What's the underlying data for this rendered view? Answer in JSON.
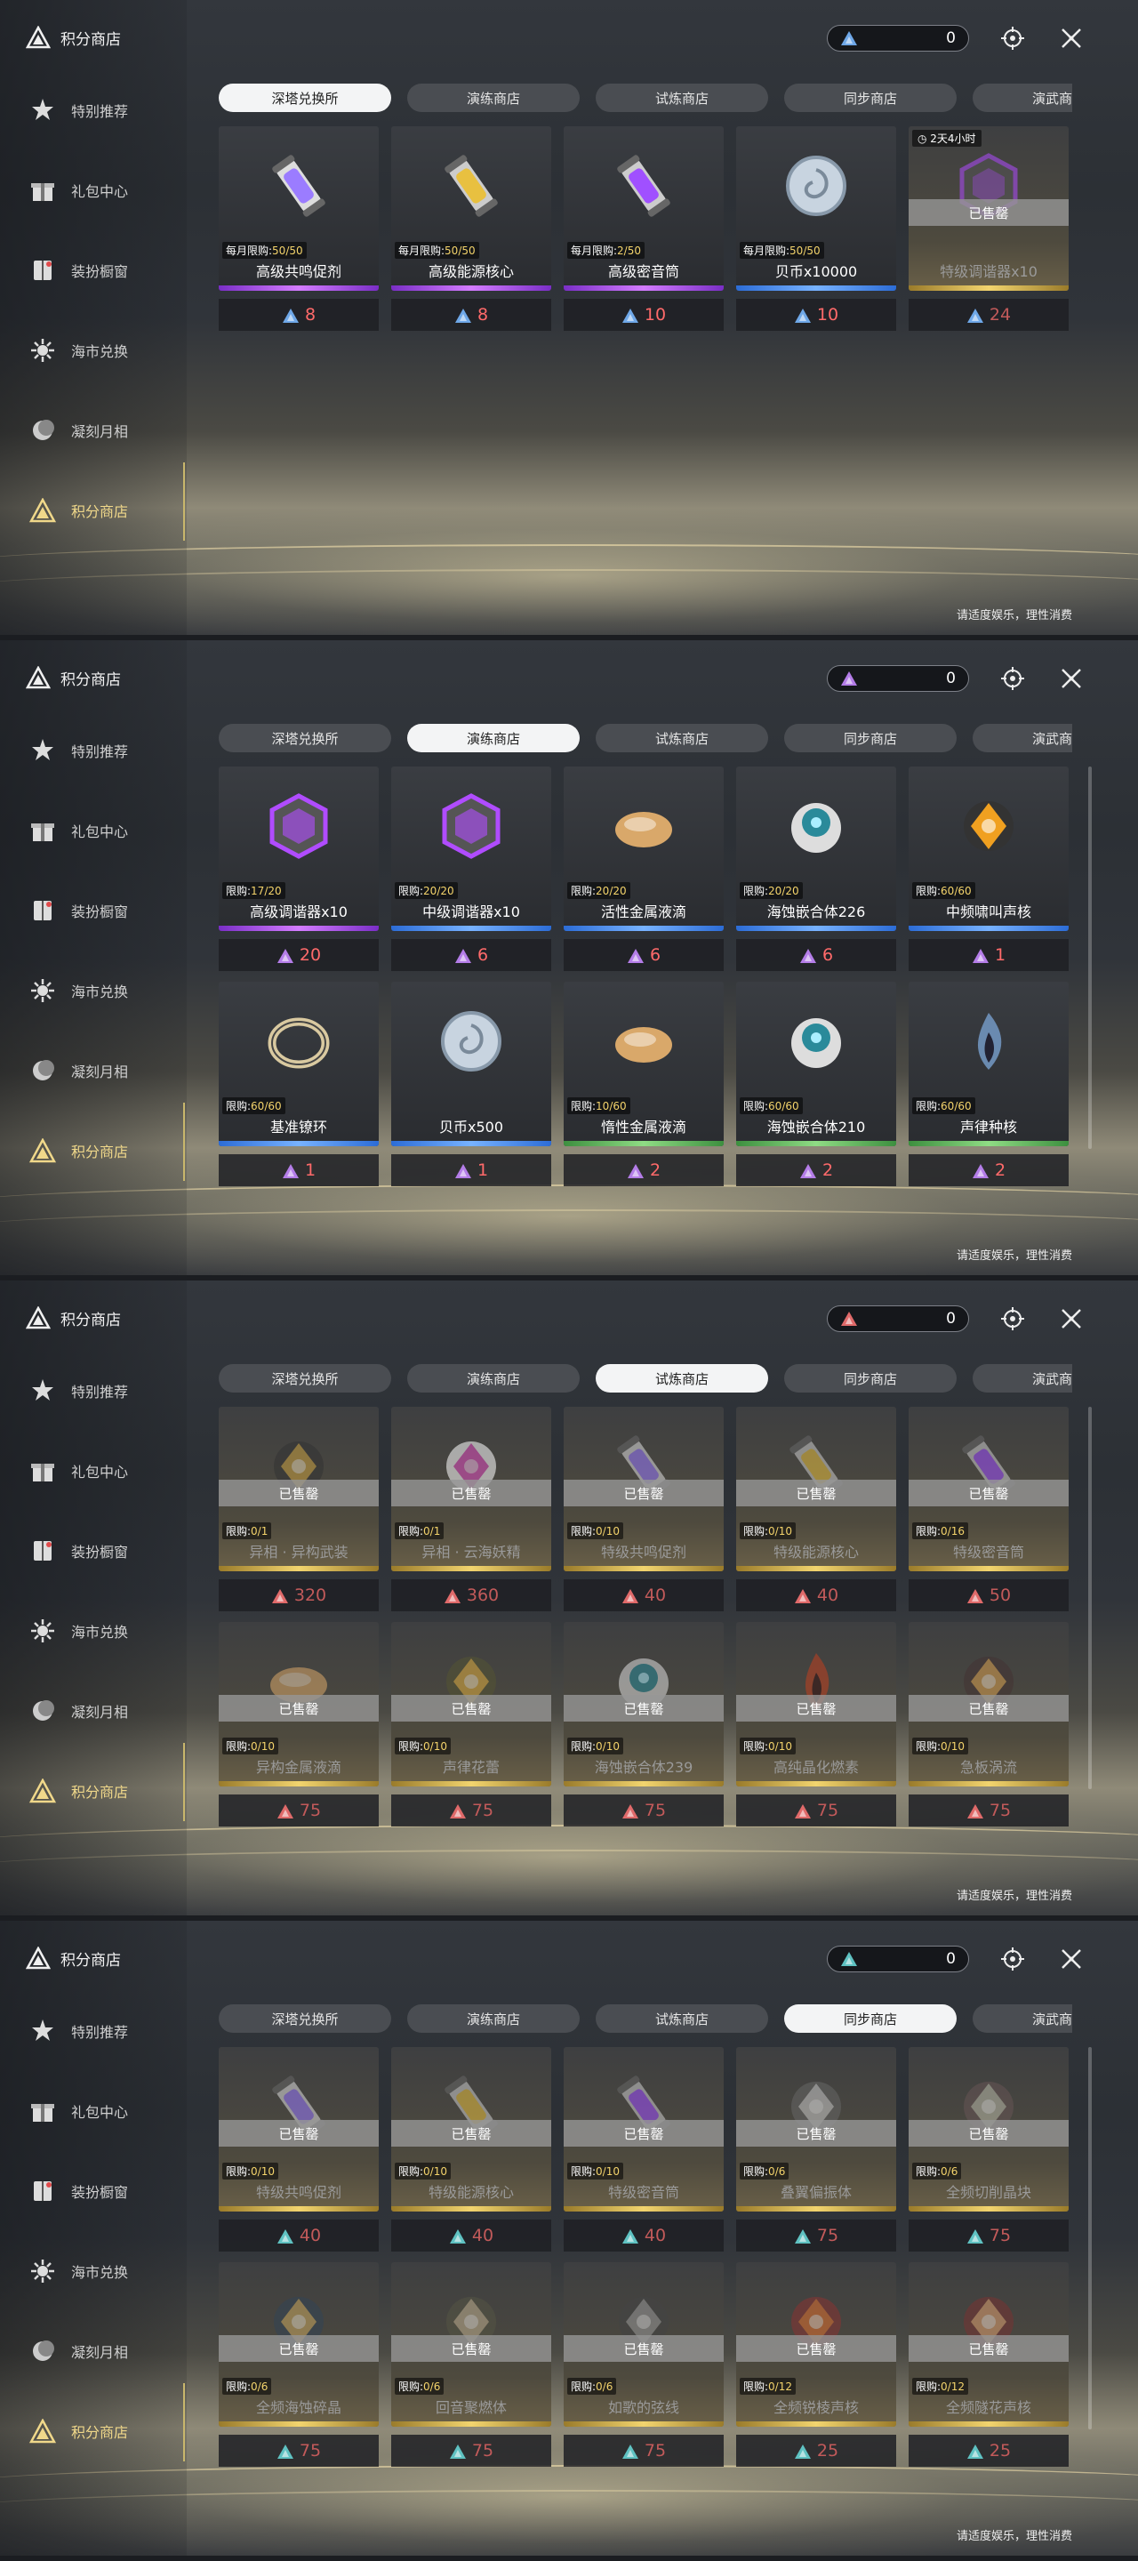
{
  "sidebar": {
    "title": "积分商店",
    "items": [
      {
        "label": "特别推荐",
        "icon": "star-hand-icon"
      },
      {
        "label": "礼包中心",
        "icon": "gift-icon"
      },
      {
        "label": "装扮橱窗",
        "icon": "wardrobe-icon"
      },
      {
        "label": "海市兑换",
        "icon": "exchange-icon"
      },
      {
        "label": "凝刻月相",
        "icon": "moon-icon"
      },
      {
        "label": "积分商店",
        "icon": "triangle-points-icon",
        "active": true
      }
    ]
  },
  "footnote": "请适度娱乐，理性消费",
  "tabs": [
    "深塔兑换所",
    "演练商店",
    "试炼商店",
    "同步商店",
    "演武商店"
  ],
  "panels": [
    {
      "currency": "0",
      "currency_color": "#6fa8e8",
      "selected_tab": 0,
      "items": [
        {
          "name": "高级共鸣促剂",
          "limit": "每月限购:",
          "count": "50/50",
          "price": "8",
          "rarity": "purple",
          "icon": "vial-icon"
        },
        {
          "name": "高级能源核心",
          "limit": "每月限购:",
          "count": "50/50",
          "price": "8",
          "rarity": "purple",
          "icon": "energy-core-icon"
        },
        {
          "name": "高级密音筒",
          "limit": "每月限购:",
          "count": "2/50",
          "price": "10",
          "rarity": "purple",
          "icon": "sound-tube-icon"
        },
        {
          "name": "贝币x10000",
          "limit": "每月限购:",
          "count": "50/50",
          "price": "10",
          "rarity": "blue",
          "icon": "shell-coin-icon"
        },
        {
          "name": "特级调谐器x10",
          "timer": "2天4小时",
          "sold": "已售罄",
          "price": "24",
          "rarity": "gold",
          "icon": "tuner-icon"
        }
      ]
    },
    {
      "currency": "0",
      "currency_color": "#b47de8",
      "selected_tab": 1,
      "items": [
        {
          "name": "高级调谐器x10",
          "limit": "限购:",
          "count": "17/20",
          "price": "20",
          "rarity": "purple",
          "icon": "tuner-icon"
        },
        {
          "name": "中级调谐器x10",
          "limit": "限购:",
          "count": "20/20",
          "price": "6",
          "rarity": "blue",
          "icon": "tuner-icon"
        },
        {
          "name": "活性金属液滴",
          "limit": "限购:",
          "count": "20/20",
          "price": "6",
          "rarity": "blue",
          "icon": "metal-drop-icon"
        },
        {
          "name": "海蚀嵌合体226",
          "limit": "限购:",
          "count": "20/20",
          "price": "6",
          "rarity": "blue",
          "icon": "orb-icon"
        },
        {
          "name": "中频啸叫声核",
          "limit": "限购:",
          "count": "60/60",
          "price": "1",
          "rarity": "blue",
          "icon": "core-icon"
        },
        {
          "name": "基准镣环",
          "limit": "限购:",
          "count": "60/60",
          "price": "1",
          "rarity": "blue",
          "icon": "ring-icon"
        },
        {
          "name": "贝币x500",
          "limit": "",
          "count": "",
          "price": "1",
          "rarity": "blue",
          "icon": "shell-coin-icon"
        },
        {
          "name": "惰性金属液滴",
          "limit": "限购:",
          "count": "10/60",
          "price": "2",
          "rarity": "green",
          "icon": "metal-drop-icon"
        },
        {
          "name": "海蚀嵌合体210",
          "limit": "限购:",
          "count": "60/60",
          "price": "2",
          "rarity": "green",
          "icon": "orb-icon"
        },
        {
          "name": "声律种核",
          "limit": "限购:",
          "count": "60/60",
          "price": "2",
          "rarity": "green",
          "icon": "flame-seed-icon"
        }
      ]
    },
    {
      "currency": "0",
      "currency_color": "#e06a6a",
      "selected_tab": 2,
      "items": [
        {
          "name": "异相 · 异构武装",
          "limit": "限购:",
          "count": "0/1",
          "sold": "已售罄",
          "price": "320",
          "rarity": "gold",
          "icon": "armor-icon"
        },
        {
          "name": "异相 · 云海妖精",
          "limit": "限购:",
          "count": "0/1",
          "sold": "已售罄",
          "price": "360",
          "rarity": "gold",
          "icon": "fairy-icon"
        },
        {
          "name": "特级共鸣促剂",
          "limit": "限购:",
          "count": "0/10",
          "sold": "已售罄",
          "price": "40",
          "rarity": "gold",
          "icon": "vial-icon"
        },
        {
          "name": "特级能源核心",
          "limit": "限购:",
          "count": "0/10",
          "sold": "已售罄",
          "price": "40",
          "rarity": "gold",
          "icon": "energy-core-icon"
        },
        {
          "name": "特级密音筒",
          "limit": "限购:",
          "count": "0/16",
          "sold": "已售罄",
          "price": "50",
          "rarity": "gold",
          "icon": "sound-tube-icon"
        },
        {
          "name": "异构金属液滴",
          "limit": "限购:",
          "count": "0/10",
          "sold": "已售罄",
          "price": "75",
          "rarity": "gold",
          "icon": "metal-drop-icon"
        },
        {
          "name": "声律花蕾",
          "limit": "限购:",
          "count": "0/10",
          "sold": "已售罄",
          "price": "75",
          "rarity": "gold",
          "icon": "bud-icon"
        },
        {
          "name": "海蚀嵌合体239",
          "limit": "限购:",
          "count": "0/10",
          "sold": "已售罄",
          "price": "75",
          "rarity": "gold",
          "icon": "orb-icon"
        },
        {
          "name": "高纯晶化燃素",
          "limit": "限购:",
          "count": "0/10",
          "sold": "已售罄",
          "price": "75",
          "rarity": "gold",
          "icon": "flame-icon"
        },
        {
          "name": "急板涡流",
          "limit": "限购:",
          "count": "0/10",
          "sold": "已售罄",
          "price": "75",
          "rarity": "gold",
          "icon": "vortex-icon"
        }
      ]
    },
    {
      "currency": "0",
      "currency_color": "#5fc2c2",
      "selected_tab": 3,
      "items": [
        {
          "name": "特级共鸣促剂",
          "limit": "限购:",
          "count": "0/10",
          "sold": "已售罄",
          "price": "40",
          "rarity": "gold",
          "icon": "vial-icon"
        },
        {
          "name": "特级能源核心",
          "limit": "限购:",
          "count": "0/10",
          "sold": "已售罄",
          "price": "40",
          "rarity": "gold",
          "icon": "energy-core-icon"
        },
        {
          "name": "特级密音筒",
          "limit": "限购:",
          "count": "0/10",
          "sold": "已售罄",
          "price": "40",
          "rarity": "gold",
          "icon": "sound-tube-icon"
        },
        {
          "name": "叠翼偏振体",
          "limit": "限购:",
          "count": "0/6",
          "sold": "已售罄",
          "price": "75",
          "rarity": "gold",
          "icon": "wing-icon"
        },
        {
          "name": "全频切削晶块",
          "limit": "限购:",
          "count": "0/6",
          "sold": "已售罄",
          "price": "75",
          "rarity": "gold",
          "icon": "crystal-icon"
        },
        {
          "name": "全频海蚀碎晶",
          "limit": "限购:",
          "count": "0/6",
          "sold": "已售罄",
          "price": "75",
          "rarity": "gold",
          "icon": "shard-icon"
        },
        {
          "name": "回音聚燃体",
          "limit": "限购:",
          "count": "0/6",
          "sold": "已售罄",
          "price": "75",
          "rarity": "gold",
          "icon": "echo-icon"
        },
        {
          "name": "如歌的弦线",
          "limit": "限购:",
          "count": "0/6",
          "sold": "已售罄",
          "price": "75",
          "rarity": "gold",
          "icon": "string-icon"
        },
        {
          "name": "全频锐棱声核",
          "limit": "限购:",
          "count": "0/12",
          "sold": "已售罄",
          "price": "25",
          "rarity": "gold",
          "icon": "prism-icon"
        },
        {
          "name": "全频隧花声核",
          "limit": "限购:",
          "count": "0/12",
          "sold": "已售罄",
          "price": "25",
          "rarity": "gold",
          "icon": "flower-core-icon"
        }
      ]
    }
  ]
}
